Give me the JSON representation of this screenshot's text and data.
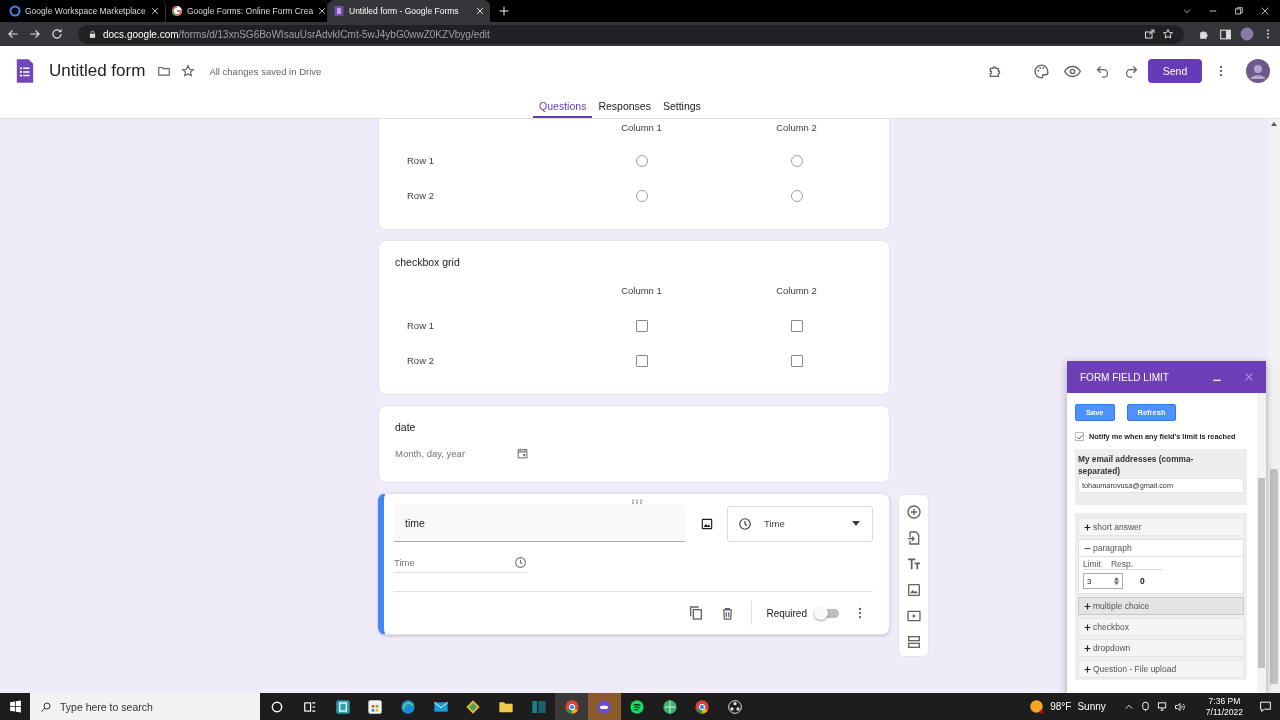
{
  "browser": {
    "tabs": [
      {
        "title": "Google Workspace Marketplace",
        "selected": false
      },
      {
        "title": "Google Forms: Online Form Crea",
        "selected": false
      },
      {
        "title": "Untitled form - Google Forms",
        "selected": true
      }
    ],
    "url_host": "docs.google.com",
    "url_path": "/forms/d/13xnSG6BoWIsauUsrAdvkICmt-5wJ4ybG0wwZ0KZVbyg/edit"
  },
  "form": {
    "title": "Untitled form",
    "save_status": "All changes saved in Drive",
    "send_label": "Send",
    "tabs": [
      {
        "label": "Questions",
        "selected": true
      },
      {
        "label": "Responses",
        "selected": false
      },
      {
        "label": "Settings",
        "selected": false
      }
    ]
  },
  "questions": [
    {
      "kind": "radio_grid",
      "columns": [
        "Column 1",
        "Column 2"
      ],
      "rows": [
        "Row 1",
        "Row 2"
      ],
      "selected": false
    },
    {
      "kind": "checkbox_grid",
      "title": "checkbox grid",
      "columns": [
        "Column 1",
        "Column 2"
      ],
      "rows": [
        "Row 1",
        "Row 2"
      ],
      "selected": false
    },
    {
      "kind": "date",
      "title": "date",
      "placeholder": "Month, day, year",
      "selected": false
    },
    {
      "kind": "time",
      "title": "time",
      "type_label": "Time",
      "placeholder": "Time",
      "required_label": "Required",
      "required": false,
      "selected": true
    }
  ],
  "addon": {
    "title": "FORM FIELD LIMIT",
    "buttons": [
      "Save",
      "Refresh"
    ],
    "notify": {
      "label": "Notify me when any field's limit is reached",
      "checked": true
    },
    "email_label": "My email addresses (comma-separated)",
    "email_value": "tohaumarovusa@gmail.com",
    "sections": [
      {
        "label": "short answer",
        "expanded": false,
        "hovered": false
      },
      {
        "label": "paragraph",
        "expanded": true,
        "hovered": false,
        "limit_label": "Limit",
        "resp_label": "Resp.",
        "limit": "3",
        "responses": "0"
      },
      {
        "label": "multiple choice",
        "expanded": false,
        "hovered": true
      },
      {
        "label": "checkbox",
        "expanded": false,
        "hovered": false
      },
      {
        "label": "dropdown",
        "expanded": false,
        "hovered": false
      },
      {
        "label": "Question - File upload",
        "expanded": false,
        "hovered": false
      }
    ]
  },
  "taskbar": {
    "search_placeholder": "Type here to search",
    "temperature": "98°F",
    "weather": "Sunny",
    "time": "7:36 PM",
    "date": "7/11/2022"
  }
}
